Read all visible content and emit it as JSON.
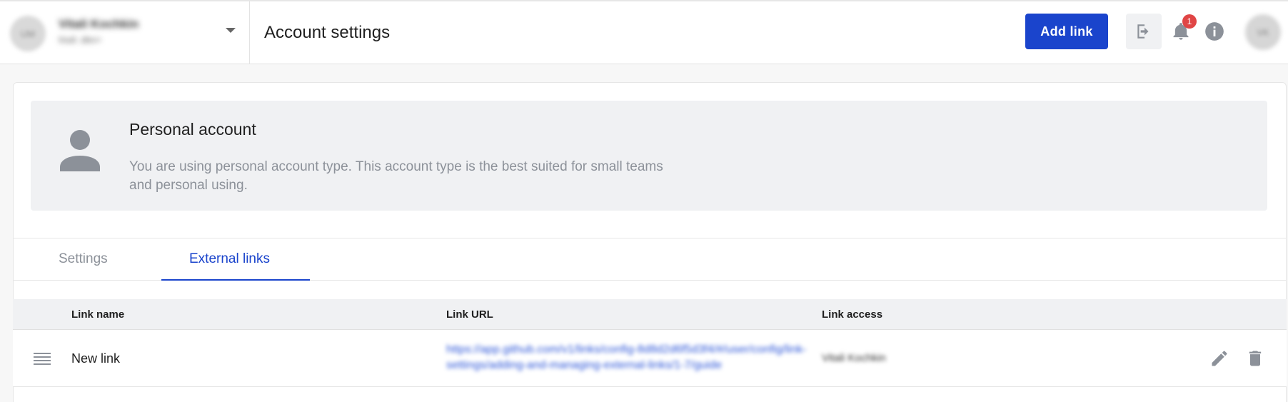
{
  "header": {
    "account": {
      "avatar_initials": "UM",
      "name": "Vitali Kochkin",
      "subtitle": "Inuit .dev+",
      "dropdown_icon": "caret-down-icon"
    },
    "title": "Account settings",
    "add_link_label": "Add link",
    "icons": {
      "logout": "logout-icon",
      "notifications": "bell-icon",
      "info": "info-icon"
    },
    "notification_count": "1",
    "user_avatar_initials": "VK"
  },
  "account_panel": {
    "icon": "person-icon",
    "title": "Personal account",
    "description": "You are using personal account type. This account type is the best suited for small teams and personal using."
  },
  "tabs": [
    {
      "label": "Settings",
      "active": false
    },
    {
      "label": "External links",
      "active": true
    }
  ],
  "table": {
    "columns": [
      "Link name",
      "Link URL",
      "Link access"
    ],
    "rows": [
      {
        "name": "New link",
        "url": "https://app.github.com/v1/links/config-8d8d2d6f5d3f4/#/user/config/link-settings/adding-and-managing-external-links/1-7/guide",
        "access": "Vitali Kochkin"
      }
    ]
  },
  "colors": {
    "primary": "#1a44cc",
    "badge": "#e04545",
    "muted_text": "#8c9199",
    "panel_bg": "#f0f1f3"
  }
}
